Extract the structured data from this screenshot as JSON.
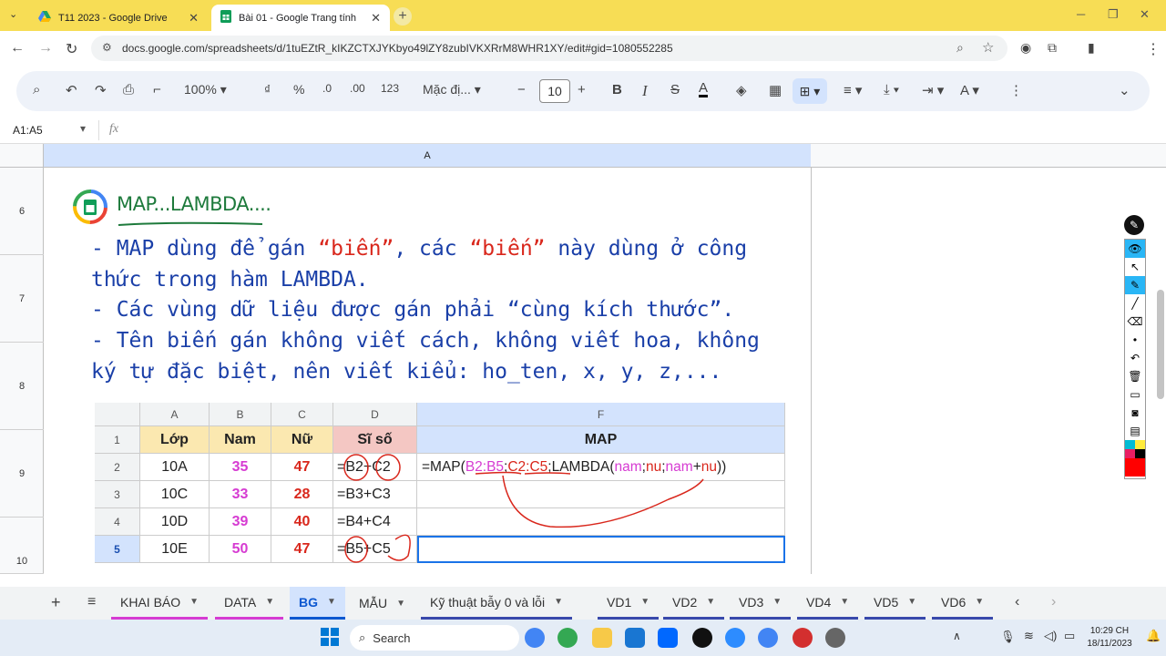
{
  "browser": {
    "tabs": [
      {
        "label": "T11 2023 - Google Drive",
        "active": false
      },
      {
        "label": "Bài 01 - Google Trang tính",
        "active": true
      }
    ],
    "url": "docs.google.com/spreadsheets/d/1tuEZtR_kIKZCTXJYKbyo49lZY8zubIVKXRrM8WHR1XY/edit#gid=1080552285"
  },
  "toolbar": {
    "zoom": "100%",
    "currency": "₫",
    "percent": "%",
    "dec_decrease": ".0",
    "dec_increase": ".00",
    "format_123": "123",
    "font": "Mặc đị...",
    "font_size": "10"
  },
  "formula_bar": {
    "name_box": "A1:A5",
    "fx": "fx"
  },
  "grid": {
    "column_header": "A",
    "rows": [
      "6",
      "7",
      "8",
      "9",
      "10"
    ]
  },
  "slide": {
    "title": "MAP...LAMBDA....",
    "lines": [
      [
        "- MAP dùng để gán ",
        "“biến”",
        ", các ",
        "“biến”",
        " này dùng ở công"
      ],
      [
        "thức trong hàm LAMBDA."
      ],
      [
        "- Các vùng dữ liệu được gán phải “cùng kích thước”."
      ],
      [
        "- Tên biến gán không viết cách, không viết hoa, không"
      ],
      [
        "ký tự đặc biệt, nên viết kiểu: ho_ten, x, y, z,..."
      ]
    ],
    "table": {
      "col_letters": [
        "A",
        "B",
        "C",
        "D",
        "F"
      ],
      "row_numbers": [
        "1",
        "2",
        "3",
        "4",
        "5"
      ],
      "header": [
        "Lớp",
        "Nam",
        "Nữ",
        "Sĩ số",
        "MAP"
      ],
      "rows": [
        [
          "10A",
          "35",
          "47",
          "=B2+C2"
        ],
        [
          "10C",
          "33",
          "28",
          "=B3+C3"
        ],
        [
          "10D",
          "39",
          "40",
          "=B4+C4"
        ],
        [
          "10E",
          "50",
          "47",
          "=B5+C5"
        ]
      ],
      "formula": {
        "prefix": "=MAP(",
        "arg1": "B2:B5",
        "sep1": ";",
        "arg2": "C2:C5",
        "sep2": ";LAMBDA(",
        "v1": "nam",
        "sep3": ";",
        "v2": "nu",
        "sep4": ";",
        "v3": "nam",
        "plus": "+",
        "v4": "nu",
        "suffix": "))"
      }
    }
  },
  "sheet_tabs": [
    "KHAI BÁO",
    "DATA",
    "BG",
    "MẪU",
    "Kỹ thuật bẫy 0 và lỗi",
    "VD1",
    "VD2",
    "VD3",
    "VD4",
    "VD5",
    "VD6"
  ],
  "active_sheet": "BG",
  "taskbar": {
    "search": "Search",
    "time": "10:29 CH",
    "date": "18/11/2023"
  },
  "colors": {
    "accent_yellow": "#f7dd55",
    "slide_blue": "#1a3fa8",
    "slide_red": "#d9271c",
    "title_green": "#1e7a3c",
    "header_yellow": "#fbe8b0",
    "header_pink": "#f4c7c3",
    "value_pink": "#d63bd2"
  }
}
